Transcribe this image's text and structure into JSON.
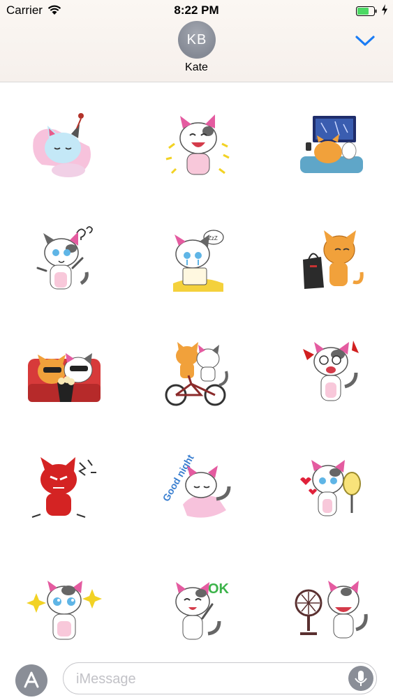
{
  "status_bar": {
    "carrier": "Carrier",
    "time": "8:22 PM",
    "icons": [
      "wifi-icon",
      "battery-icon",
      "charging-bolt-icon"
    ]
  },
  "conversation": {
    "avatar_initials": "KB",
    "contact_name": "Kate",
    "collapse_icon": "chevron-down-icon",
    "accent_color": "#1a7cf5"
  },
  "stickers": [
    {
      "name": "sticker-cat-sleeping-pillow",
      "subject": "white cat asleep on pink pillow"
    },
    {
      "name": "sticker-cat-laughing",
      "subject": "white cat laughing"
    },
    {
      "name": "sticker-cat-watching-tv",
      "subject": "orange cat and white cat watching tv on couch"
    },
    {
      "name": "sticker-cat-confused",
      "subject": "white cat confused with question marks"
    },
    {
      "name": "sticker-cat-crying-letter",
      "subject": "white cat crying holding letter"
    },
    {
      "name": "sticker-cat-shopping-bag",
      "subject": "orange cat holding shopping bag"
    },
    {
      "name": "sticker-cats-cinema",
      "subject": "two cats with sunglasses and popcorn at cinema"
    },
    {
      "name": "sticker-cats-bicycle",
      "subject": "two cats riding a bicycle"
    },
    {
      "name": "sticker-cat-shocked",
      "subject": "white cat shocked"
    },
    {
      "name": "sticker-cat-angry-red",
      "subject": "red angry cat"
    },
    {
      "name": "sticker-cat-good-night",
      "subject": "white cat sleeping"
    },
    {
      "name": "sticker-cat-love-mirror",
      "subject": "white cat with hearts and mirror"
    },
    {
      "name": "sticker-cat-sparkle-eyes",
      "subject": "white cat with sparkling eyes"
    },
    {
      "name": "sticker-cat-ok",
      "subject": "white cat saying ok"
    },
    {
      "name": "sticker-cat-fan",
      "subject": "white cat in front of electric fan"
    }
  ],
  "sticker_texts": {
    "good_night": "Good night",
    "ok": "OK",
    "zzz": "ZzZ"
  },
  "compose": {
    "app_store_icon": "app-store-icon",
    "placeholder": "iMessage",
    "value": "",
    "mic_icon": "microphone-icon"
  }
}
